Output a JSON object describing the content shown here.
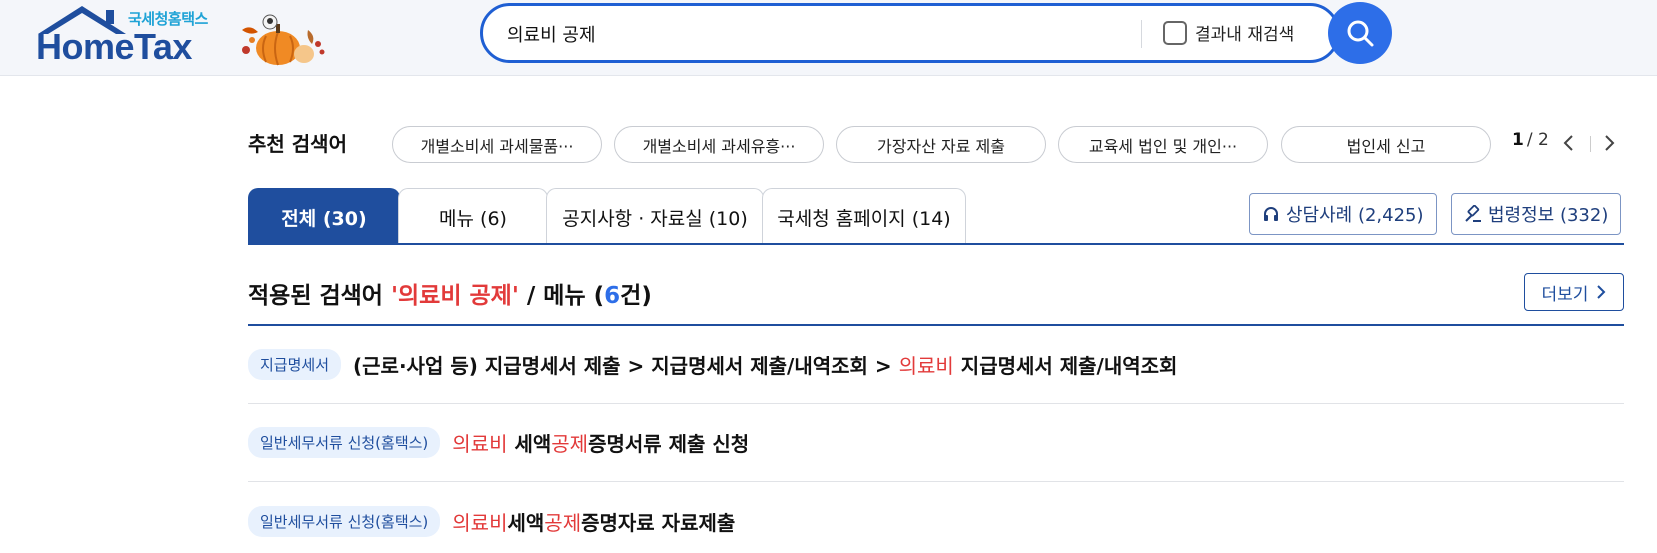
{
  "header": {
    "logo_sub": "국세청홈택스",
    "logo_main": "HomeTax",
    "search_value": "의료비 공제",
    "research_label": "결과내 재검색"
  },
  "recommend": {
    "label": "추천 검색어",
    "chips": [
      "개별소비세 과세물품···",
      "개별소비세 과세유흥···",
      "가장자산 자료 제출",
      "교육세 법인 및 개인···",
      "법인세 신고"
    ],
    "page_current": "1",
    "page_total": "/ 2"
  },
  "tabs": [
    {
      "label": "전체 (30)"
    },
    {
      "label": "메뉴 (6)"
    },
    {
      "label": "공지사항 · 자료실 (10)"
    },
    {
      "label": "국세청 홈페이지 (14)"
    }
  ],
  "side_buttons": {
    "consult": "상담사례 (2,425)",
    "law": "법령정보 (332)"
  },
  "applied": {
    "prefix": "적용된 검색어 ",
    "term": "'의료비 공제'",
    "middle": " / 메뉴 (",
    "count": "6",
    "suffix": "건)",
    "more": "더보기"
  },
  "results": [
    {
      "badge": "지급명세서",
      "p1": "(근로·사업 등) 지급명세서 제출 > 지급명세서 제출/내역조회 > ",
      "h1": "의료비",
      "p2": " 지급명세서 제출/내역조회",
      "h2": "",
      "p3": ""
    },
    {
      "badge": "일반세무서류 신청(홈택스)",
      "p1": "",
      "h1": "의료비",
      "p2": " 세액",
      "h2": "공제",
      "p3": "증명서류 제출 신청"
    },
    {
      "badge": "일반세무서류 신청(홈택스)",
      "p1": "",
      "h1": "의료비",
      "p2": "세액",
      "h2": "공제",
      "p3": "증명자료 자료제출"
    }
  ],
  "colors": {
    "brand_blue": "#1f4e9e",
    "accent_blue": "#2d6ee8",
    "highlight_red": "#e23a3a",
    "badge_bg": "#e8f1fd"
  }
}
